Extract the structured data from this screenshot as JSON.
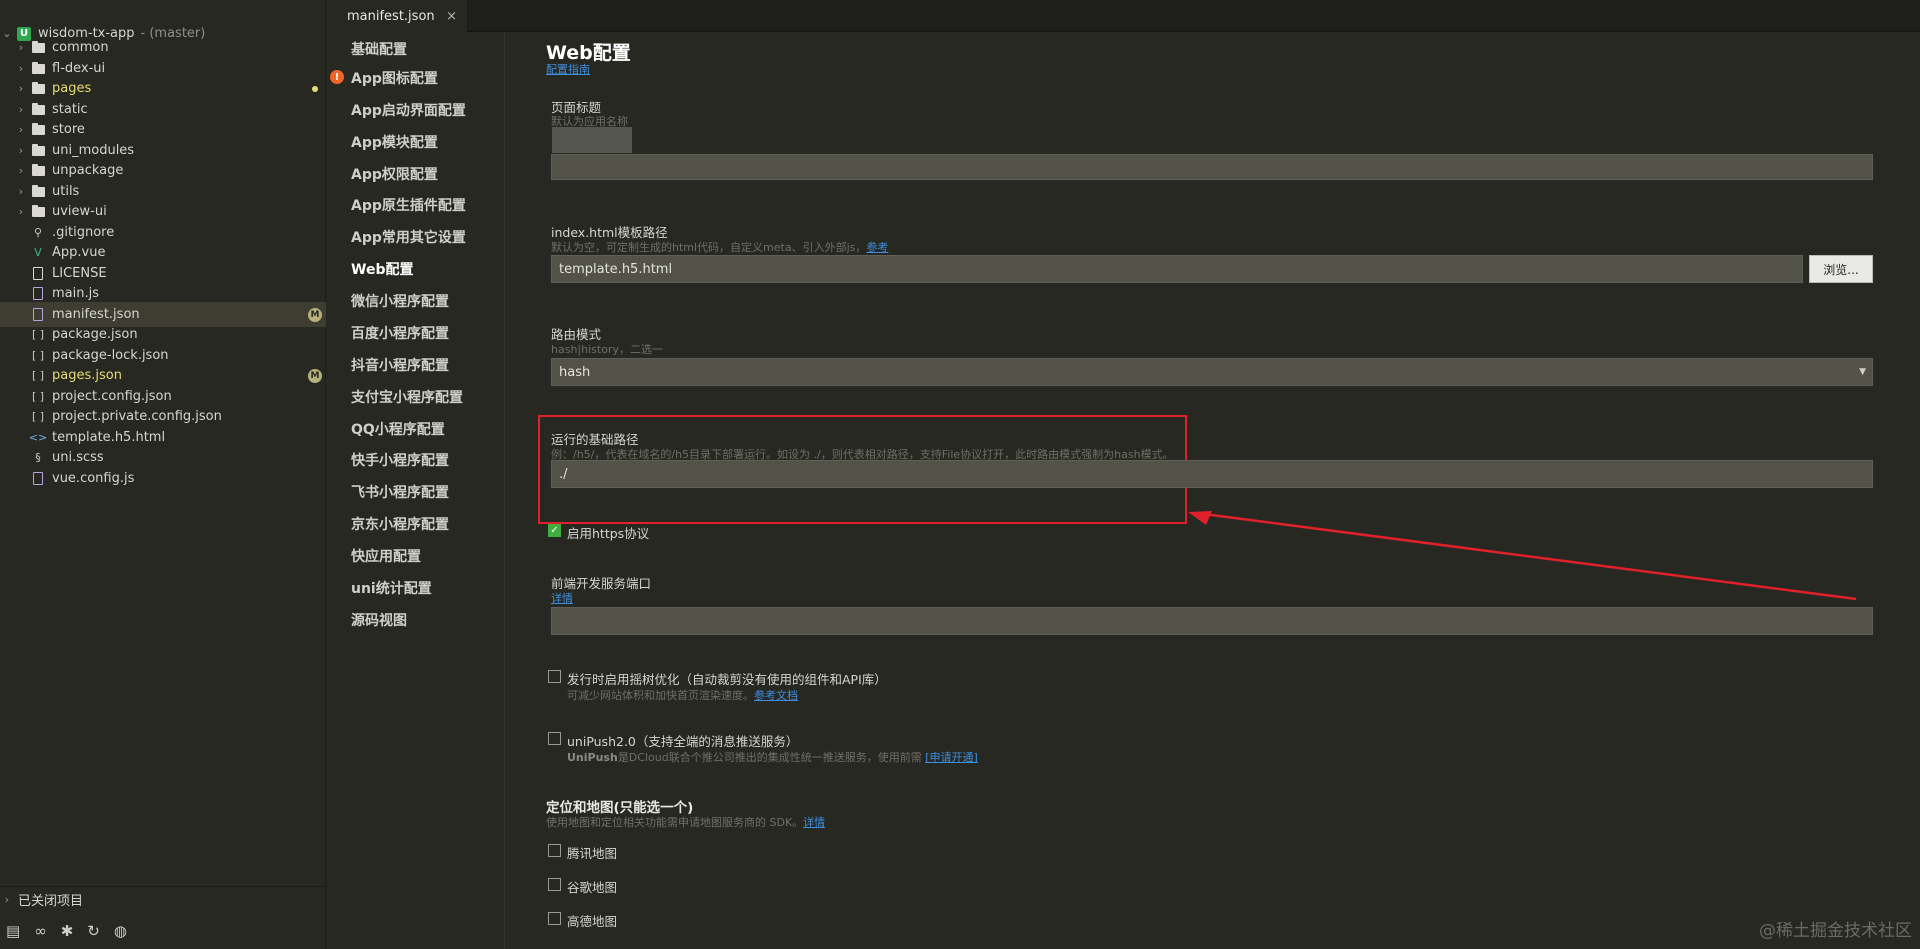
{
  "explorer": {
    "project_name": "wisdom-tx-app",
    "project_branch": "- (master)",
    "items": [
      {
        "label": "common",
        "kind": "folder"
      },
      {
        "label": "fl-dex-ui",
        "kind": "folder"
      },
      {
        "label": "pages",
        "kind": "folder"
      },
      {
        "label": "static",
        "kind": "folder"
      },
      {
        "label": "store",
        "kind": "folder"
      },
      {
        "label": "uni_modules",
        "kind": "folder"
      },
      {
        "label": "unpackage",
        "kind": "folder"
      },
      {
        "label": "utils",
        "kind": "folder"
      },
      {
        "label": "uview-ui",
        "kind": "folder"
      },
      {
        "label": ".gitignore",
        "kind": "file"
      },
      {
        "label": "App.vue",
        "kind": "vue"
      },
      {
        "label": "LICENSE",
        "kind": "file"
      },
      {
        "label": "main.js",
        "kind": "file"
      },
      {
        "label": "manifest.json",
        "kind": "json"
      },
      {
        "label": "package.json",
        "kind": "json"
      },
      {
        "label": "package-lock.json",
        "kind": "json"
      },
      {
        "label": "pages.json",
        "kind": "json"
      },
      {
        "label": "project.config.json",
        "kind": "json"
      },
      {
        "label": "project.private.config.json",
        "kind": "json"
      },
      {
        "label": "template.h5.html",
        "kind": "html"
      },
      {
        "label": "uni.scss",
        "kind": "file"
      },
      {
        "label": "vue.config.js",
        "kind": "file"
      }
    ],
    "modified_badge": "M",
    "closed_projects": "已关闭项目",
    "bottom_icons": [
      "folder-icon",
      "binoculars-icon",
      "bug-icon",
      "refresh-icon",
      "globe-icon"
    ]
  },
  "tab": {
    "label": "manifest.json",
    "close": "×"
  },
  "config_nav": [
    "基础配置",
    "App图标配置",
    "App启动界面配置",
    "App模块配置",
    "App权限配置",
    "App原生插件配置",
    "App常用其它设置",
    "Web配置",
    "微信小程序配置",
    "百度小程序配置",
    "抖音小程序配置",
    "支付宝小程序配置",
    "QQ小程序配置",
    "快手小程序配置",
    "飞书小程序配置",
    "京东小程序配置",
    "快应用配置",
    "uni统计配置",
    "源码视图"
  ],
  "config_nav_active": "Web配置",
  "config_nav_warning": "!",
  "web": {
    "title": "Web配置",
    "guide_link": "配置指南",
    "page_title": {
      "label": "页面标题",
      "hint": "默认为应用名称",
      "value": ""
    },
    "template": {
      "label": "index.html模板路径",
      "hint": "默认为空，可定制生成的html代码，自定义meta、引入外部js，",
      "hint_link": "参考",
      "value": "template.h5.html",
      "browse": "浏览..."
    },
    "router": {
      "label": "路由模式",
      "hint": "hash|history，二选一",
      "value": "hash",
      "arrow": "▼"
    },
    "base_path": {
      "label": "运行的基础路径",
      "hint": "例：/h5/，代表在域名的/h5目录下部署运行。如设为 ./，则代表相对路径，支持File协议打开，此时路由模式强制为hash模式。",
      "value": "./"
    },
    "https": {
      "label": "启用https协议",
      "checked": true,
      "mark": "✓"
    },
    "dev_port": {
      "label": "前端开发服务端口",
      "link": "详情",
      "value": ""
    },
    "tree_shaking": {
      "label": "发行时启用摇树优化（自动裁剪没有使用的组件和API库）",
      "hint": "可减少网站体积和加快首页渲染速度。",
      "link": "参考文档",
      "checked": false
    },
    "unipush": {
      "label": "uniPush2.0（支持全端的消息推送服务）",
      "hint_bold": "UniPush",
      "hint": "是DCloud联合个推公司推出的集成性统一推送服务，使用前需",
      "link": "[申请开通]",
      "checked": false
    },
    "map": {
      "title": "定位和地图(只能选一个)",
      "hint": "使用地图和定位相关功能需申请地图服务商的 SDK。",
      "link": "详情",
      "options": [
        {
          "label": "腾讯地图",
          "checked": false
        },
        {
          "label": "谷歌地图",
          "checked": false
        },
        {
          "label": "高德地图",
          "checked": false
        }
      ]
    }
  },
  "watermark": "@稀土掘金技术社区",
  "colors": {
    "highlight": "#e0202a",
    "link": "#3d8fe0",
    "checkbox_checked": "#3fae3f",
    "modified": "#e6db74"
  }
}
